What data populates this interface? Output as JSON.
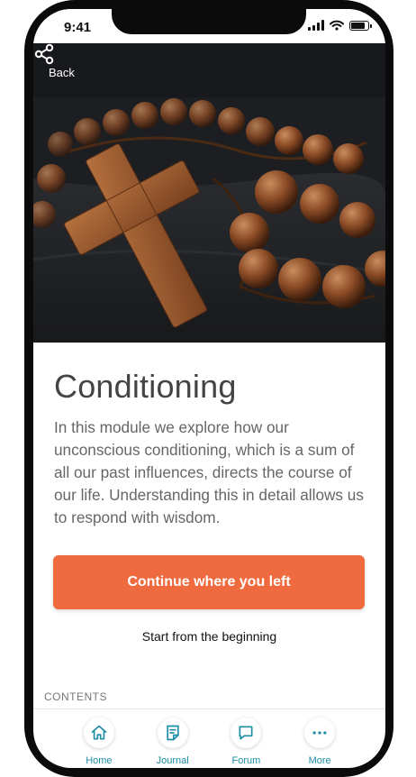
{
  "status_bar": {
    "time": "9:41"
  },
  "header": {
    "back_label": "Back"
  },
  "module": {
    "title": "Conditioning",
    "description": "In this module we explore how our unconscious conditioning, which is a sum of all our past influences, directs the course of our life. Understanding this in detail allows us to respond with wisdom."
  },
  "actions": {
    "continue_label": "Continue where you left",
    "restart_label": "Start from the beginning"
  },
  "contents": {
    "heading": "CONTENTS"
  },
  "tabbar": {
    "items": [
      {
        "label": "Home",
        "icon": "home-icon"
      },
      {
        "label": "Journal",
        "icon": "journal-icon"
      },
      {
        "label": "Forum",
        "icon": "chat-icon"
      },
      {
        "label": "More",
        "icon": "more-icon"
      }
    ]
  },
  "colors": {
    "accent": "#ef6b3f",
    "tab_tint": "#1e8da6",
    "title_text": "#444444",
    "body_text": "#666666"
  }
}
